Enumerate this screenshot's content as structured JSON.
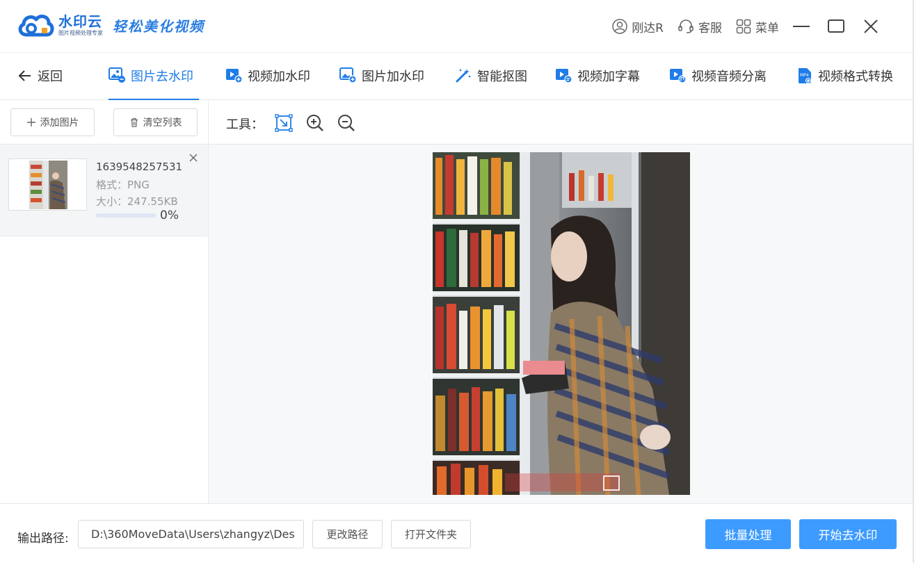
{
  "app": {
    "brand_name": "水印云",
    "brand_sub": "图片视频处理专家",
    "slogan": "轻松美化视频"
  },
  "titlebar": {
    "user": "刚达R",
    "service": "客服",
    "menu": "菜单"
  },
  "nav": {
    "back": "返回",
    "tabs": [
      {
        "label": "图片去水印",
        "icon": "image-remove-icon",
        "active": true
      },
      {
        "label": "视频加水印",
        "icon": "video-add-icon"
      },
      {
        "label": "图片加水印",
        "icon": "image-add-icon"
      },
      {
        "label": "智能抠图",
        "icon": "magic-wand-icon"
      },
      {
        "label": "视频加字幕",
        "icon": "video-subtitle-icon"
      },
      {
        "label": "视频音频分离",
        "icon": "video-audio-icon"
      },
      {
        "label": "视频格式转换",
        "icon": "mp4-icon"
      }
    ]
  },
  "left": {
    "add_image": "添加图片",
    "clear_list": "清空列表",
    "files": [
      {
        "name": "1639548257531",
        "format": "格式：PNG",
        "size": "大小：247.55KB",
        "progress": 0,
        "progress_text": "0%"
      }
    ]
  },
  "tools": {
    "label": "工具："
  },
  "bottom": {
    "output_label": "输出路径:",
    "output_path": "D:\\360MoveData\\Users\\zhangyz\\Des",
    "change_path": "更改路径",
    "open_folder": "打开文件夹",
    "batch": "批量处理",
    "start": "开始去水印"
  },
  "colors": {
    "accent": "#1f7ce8",
    "primary_button": "#3d9bff"
  }
}
